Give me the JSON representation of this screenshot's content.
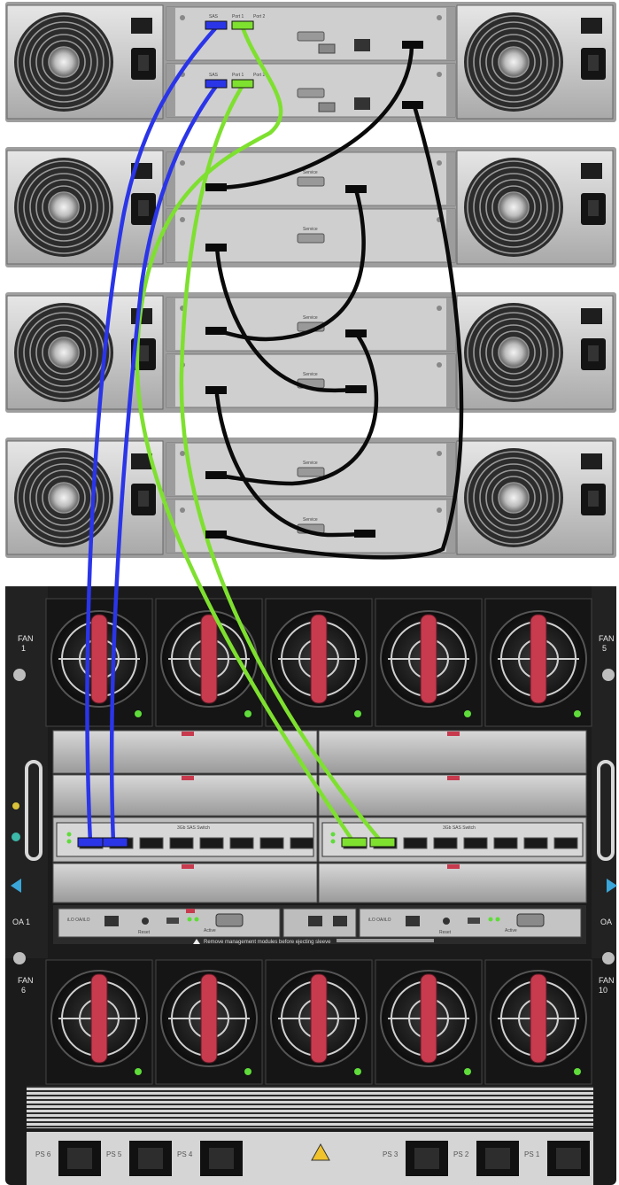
{
  "title": "",
  "storage": {
    "shelf_count": 4,
    "top_controller_labels": [
      "SAS",
      "Port 1",
      "Port 2",
      "SAS",
      "Port 1",
      "Port 2"
    ],
    "service_label": "Service"
  },
  "enclosure": {
    "fan_labels": {
      "fan1_word": "FAN",
      "fan1_num": "1",
      "fan5_word": "FAN",
      "fan5_num": "5",
      "fan6_word": "FAN",
      "fan6_num": "6",
      "fan10_word": "FAN",
      "fan10_num": "10"
    },
    "oa1_label": "OA 1",
    "oa2_label": "OA",
    "oa_port_label": "iLO OA/iLO",
    "reset_label": "Reset",
    "active_label": "Active",
    "warning_text": "Remove management modules before ejecting sleeve",
    "switch_label": "3Gb SAS Switch",
    "ps_labels": [
      "PS 6",
      "PS 5",
      "PS 4",
      "PS 3",
      "PS 2",
      "PS 1"
    ]
  },
  "colors": {
    "sas_blue": "#2b35e8",
    "sas_green": "#7ee02f",
    "sas_black": "#0a0a0a",
    "chassis_dark": "#1c1c1c",
    "shelf_gray": "#cfcfcf",
    "fan_red": "#c83a4e"
  },
  "icons": [
    "fan-icon",
    "power-socket-icon",
    "warning-icon",
    "rj45-port-icon",
    "usb-port-icon",
    "vga-port-icon",
    "led-icon"
  ]
}
